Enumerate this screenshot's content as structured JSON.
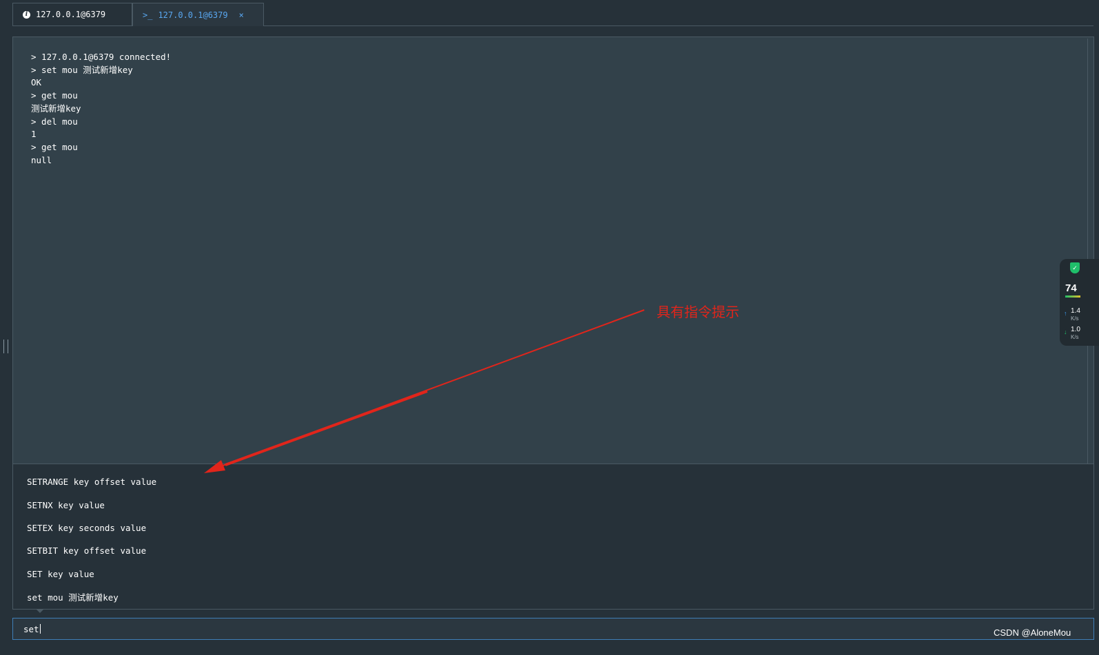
{
  "tabs": [
    {
      "icon": "info-icon",
      "label": "127.0.0.1@6379"
    },
    {
      "icon": "terminal-icon",
      "icon_glyph": ">_",
      "label": "127.0.0.1@6379",
      "close_glyph": "×"
    }
  ],
  "console": {
    "lines": [
      "> 127.0.0.1@6379 connected!",
      "> set mou 测试新增key",
      "OK",
      "> get mou",
      "测试新增key",
      "> del mou",
      "1",
      "> get mou",
      "null"
    ]
  },
  "suggestions": [
    "SETRANGE key offset value",
    "SETNX key value",
    "SETEX key seconds value",
    "SETBIT key offset value",
    "SET key value",
    "set mou 测试新增key"
  ],
  "input": {
    "value": "set"
  },
  "annotation": {
    "text": "具有指令提示",
    "color": "#e1251b"
  },
  "widget": {
    "score": "74",
    "upload": {
      "value": "1.4",
      "unit": "K/s"
    },
    "download": {
      "value": "1.0",
      "unit": "K/s"
    }
  },
  "watermark": "CSDN @AloneMou",
  "colors": {
    "background": "#263139",
    "console_bg": "#32414a",
    "accent": "#59a7f0"
  }
}
